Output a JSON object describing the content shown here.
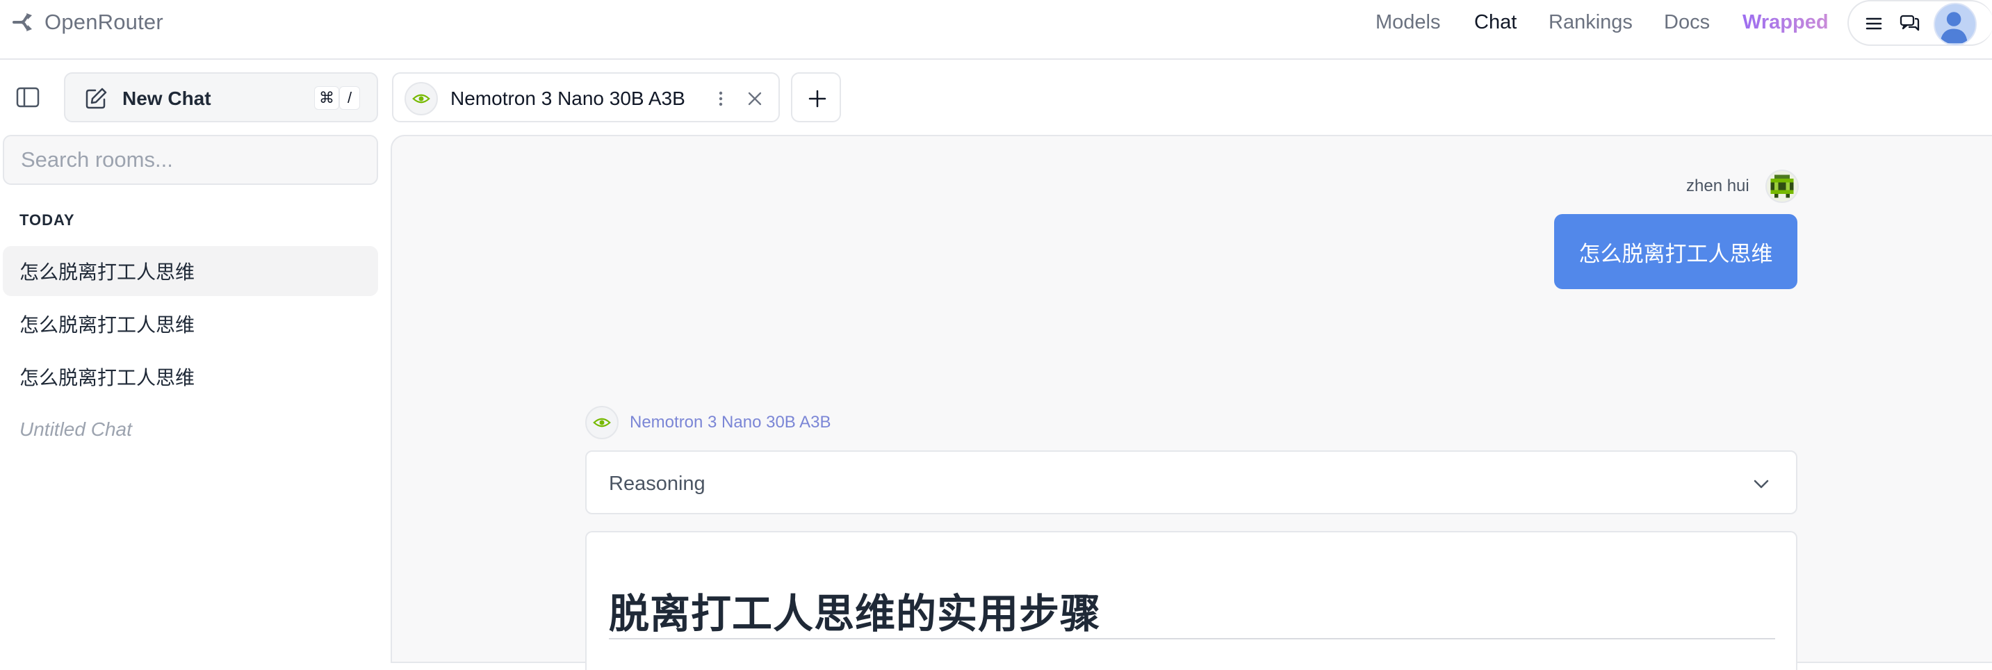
{
  "header": {
    "brand": "OpenRouter",
    "nav": [
      {
        "label": "Models",
        "active": false
      },
      {
        "label": "Chat",
        "active": true
      },
      {
        "label": "Rankings",
        "active": false
      },
      {
        "label": "Docs",
        "active": false
      },
      {
        "label": "Wrapped",
        "active": false
      }
    ],
    "icons": [
      "menu-icon",
      "chat-bubbles-icon",
      "user-avatar"
    ]
  },
  "sidebar": {
    "new_chat_label": "New Chat",
    "shortcut_keys": [
      "⌘",
      "/"
    ],
    "search_placeholder": "Search rooms...",
    "section_title": "TODAY",
    "rooms": [
      {
        "label": "怎么脱离打工人思维",
        "selected": true
      },
      {
        "label": "怎么脱离打工人思维",
        "selected": false
      },
      {
        "label": "怎么脱离打工人思维",
        "selected": false
      },
      {
        "label": "Untitled Chat",
        "selected": false
      }
    ]
  },
  "tabs": [
    {
      "label": "Nemotron 3 Nano 30B A3B",
      "icon": "nvidia-logo"
    }
  ],
  "chat": {
    "user_name": "zhen hui",
    "user_message": "怎么脱离打工人思维",
    "model_name": "Nemotron 3 Nano 30B A3B",
    "reasoning_label": "Reasoning",
    "answer_heading": "脱离打工人思维的实用步骤"
  },
  "colors": {
    "user_bubble": "#5288ea",
    "model_name": "#7b86d6",
    "wrapped_gradient_start": "#9d6ef0",
    "wrapped_gradient_end": "#c98bd8",
    "nvidia_green": "#76b900"
  }
}
